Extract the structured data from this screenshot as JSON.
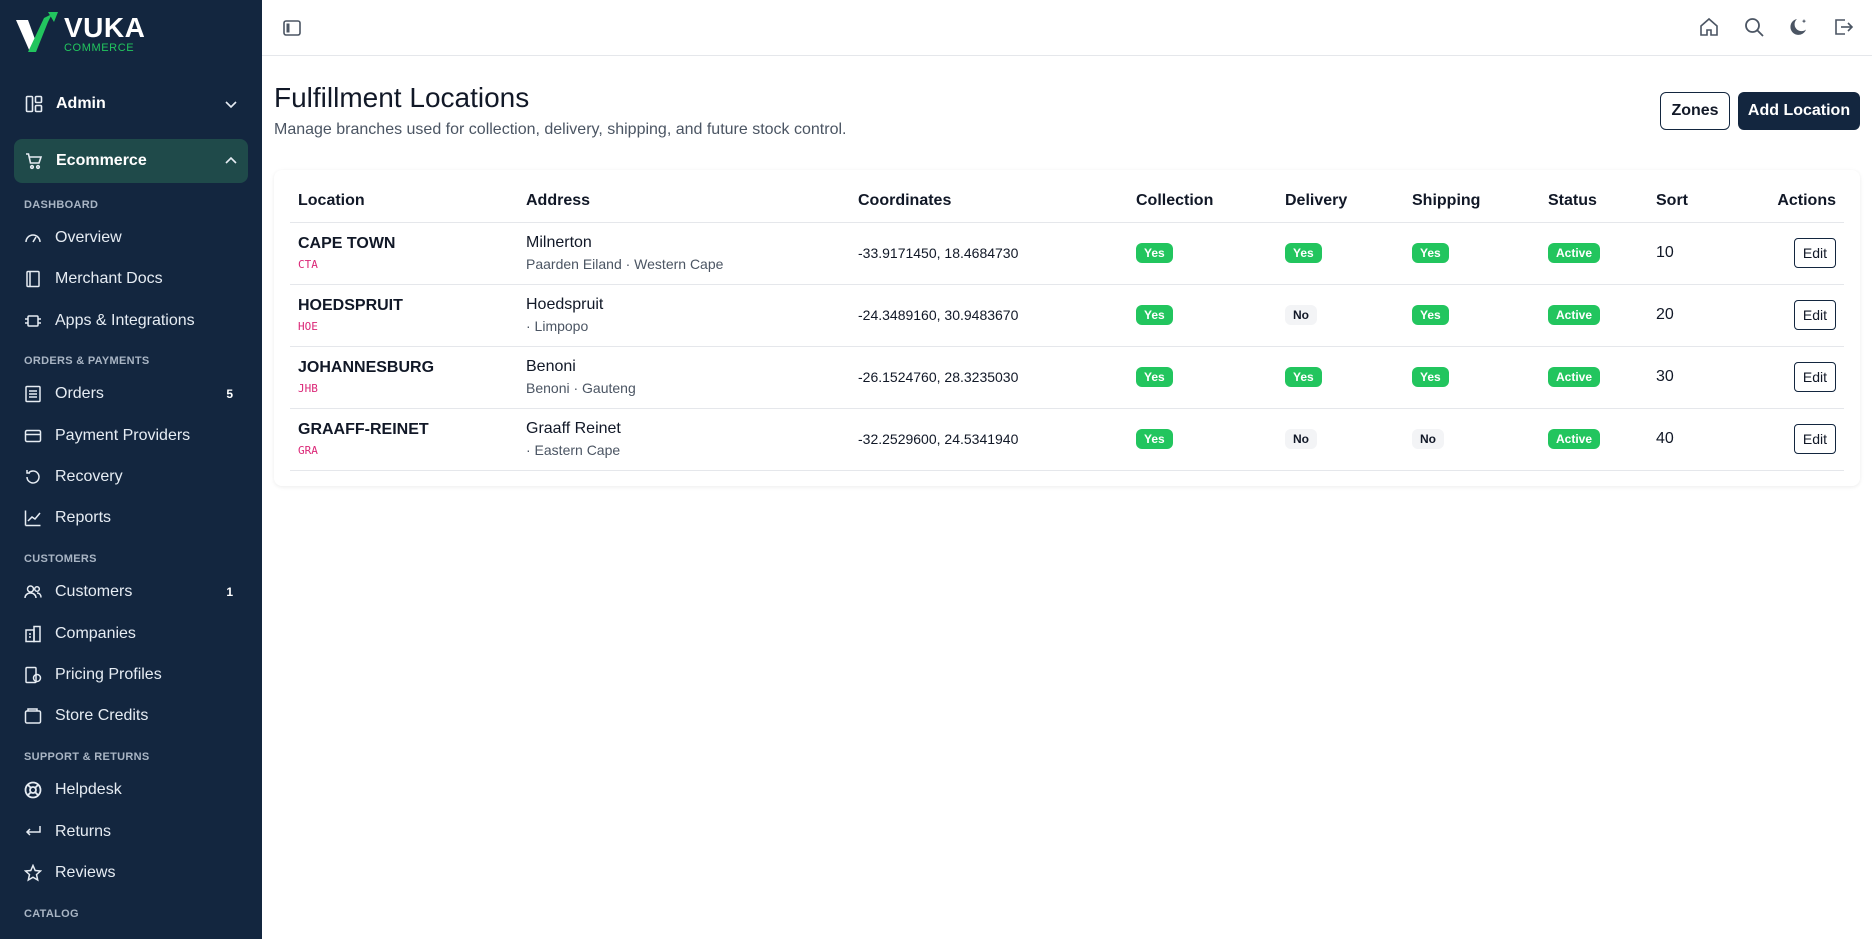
{
  "brand": {
    "name": "VUKA",
    "tagline": "COMMERCE"
  },
  "sidebar": {
    "admin_label": "Admin",
    "ecommerce_label": "Ecommerce",
    "sections": {
      "dashboard": "DASHBOARD",
      "orders_payments": "ORDERS & PAYMENTS",
      "customers": "CUSTOMERS",
      "support_returns": "SUPPORT & RETURNS",
      "catalog": "CATALOG"
    },
    "items": {
      "overview": "Overview",
      "merchant_docs": "Merchant Docs",
      "apps_integrations": "Apps & Integrations",
      "orders": "Orders",
      "orders_badge": "5",
      "payment_providers": "Payment Providers",
      "recovery": "Recovery",
      "reports": "Reports",
      "customers": "Customers",
      "customers_badge": "1",
      "companies": "Companies",
      "pricing_profiles": "Pricing Profiles",
      "store_credits": "Store Credits",
      "helpdesk": "Helpdesk",
      "returns": "Returns",
      "reviews": "Reviews"
    }
  },
  "page": {
    "title": "Fulfillment Locations",
    "subtitle": "Manage branches used for collection, delivery, shipping, and future stock control.",
    "zones_button": "Zones",
    "add_button": "Add Location"
  },
  "table": {
    "headers": {
      "location": "Location",
      "address": "Address",
      "coordinates": "Coordinates",
      "collection": "Collection",
      "delivery": "Delivery",
      "shipping": "Shipping",
      "status": "Status",
      "sort": "Sort",
      "actions": "Actions"
    },
    "edit_label": "Edit",
    "rows": [
      {
        "name": "CAPE TOWN",
        "code": "CTA",
        "addr": "Milnerton",
        "addr_sub": "Paarden Eiland · Western Cape",
        "coords": "-33.9171450, 18.4684730",
        "collection": "Yes",
        "delivery": "Yes",
        "shipping": "Yes",
        "status": "Active",
        "sort": "10"
      },
      {
        "name": "HOEDSPRUIT",
        "code": "HOE",
        "addr": "Hoedspruit",
        "addr_sub": "· Limpopo",
        "coords": "-24.3489160, 30.9483670",
        "collection": "Yes",
        "delivery": "No",
        "shipping": "Yes",
        "status": "Active",
        "sort": "20"
      },
      {
        "name": "JOHANNESBURG",
        "code": "JHB",
        "addr": "Benoni",
        "addr_sub": "Benoni · Gauteng",
        "coords": "-26.1524760, 28.3235030",
        "collection": "Yes",
        "delivery": "Yes",
        "shipping": "Yes",
        "status": "Active",
        "sort": "30"
      },
      {
        "name": "GRAAFF-REINET",
        "code": "GRA",
        "addr": "Graaff Reinet",
        "addr_sub": "· Eastern Cape",
        "coords": "-32.2529600, 24.5341940",
        "collection": "Yes",
        "delivery": "No",
        "shipping": "No",
        "status": "Active",
        "sort": "40"
      }
    ]
  }
}
